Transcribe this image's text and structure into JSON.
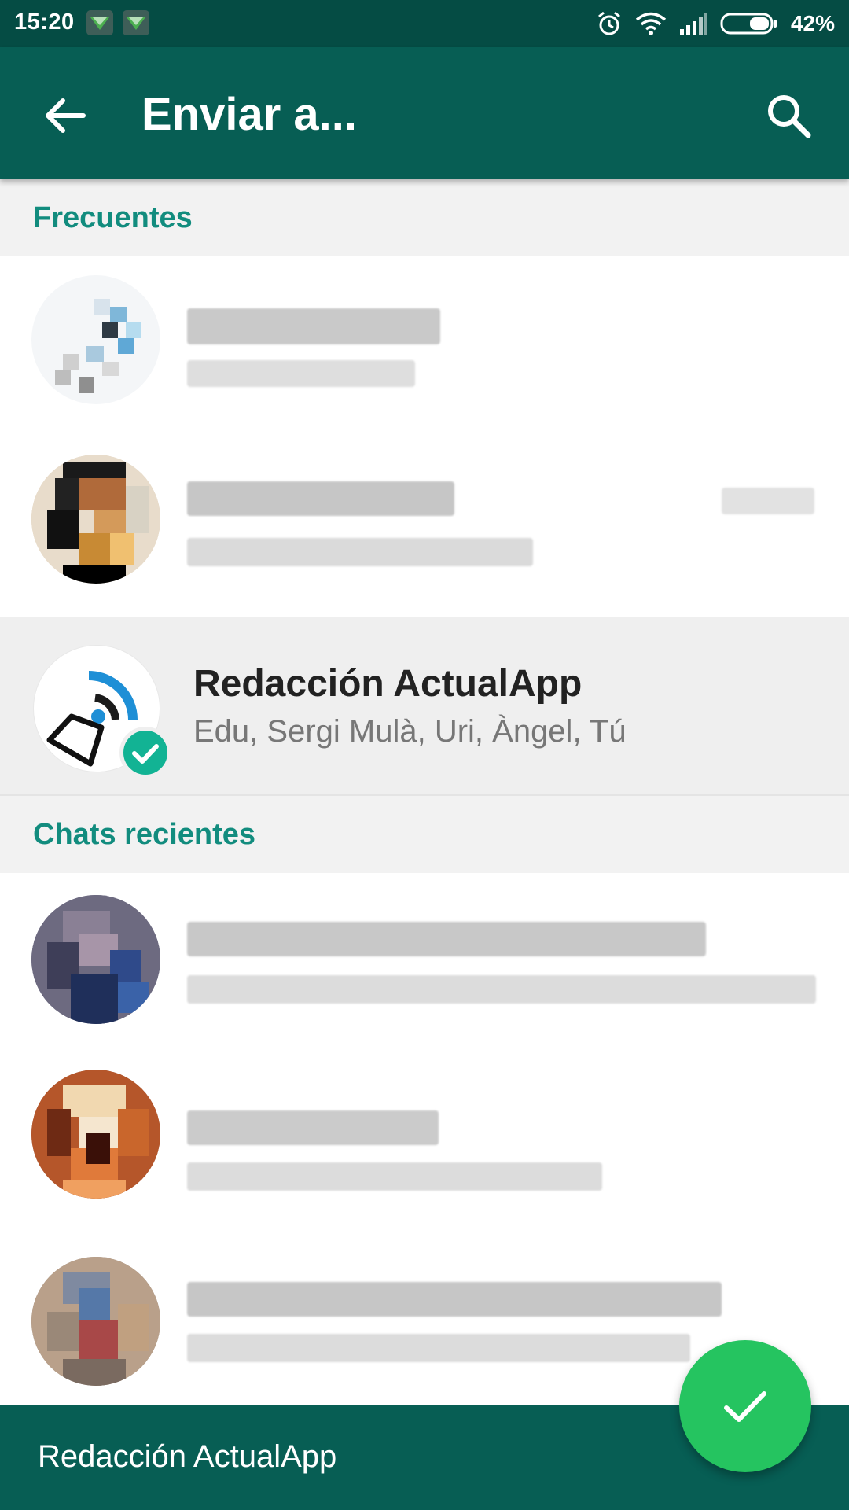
{
  "status_bar": {
    "time": "15:20",
    "battery_percent": "42%",
    "icons": [
      "notification-icon",
      "notification-icon",
      "alarm-icon",
      "wifi-icon",
      "signal-icon",
      "battery-icon"
    ]
  },
  "app_bar": {
    "title": "Enviar a...",
    "back_icon": "arrow-back-icon",
    "search_icon": "search-icon"
  },
  "sections": {
    "frequent": "Frecuentes",
    "recent": "Chats recientes"
  },
  "selected_chat": {
    "name": "Redacción ActualApp",
    "members": "Edu, Sergi Mulà, Uri, Àngel, Tú",
    "selected": true
  },
  "bottom_bar": {
    "selected_names": "Redacción ActualApp"
  },
  "fab": {
    "icon": "check-icon"
  },
  "colors": {
    "status_bar": "#054c44",
    "primary": "#075e54",
    "accent": "#128c7e",
    "fab": "#25c460",
    "check_badge": "#12b394"
  }
}
